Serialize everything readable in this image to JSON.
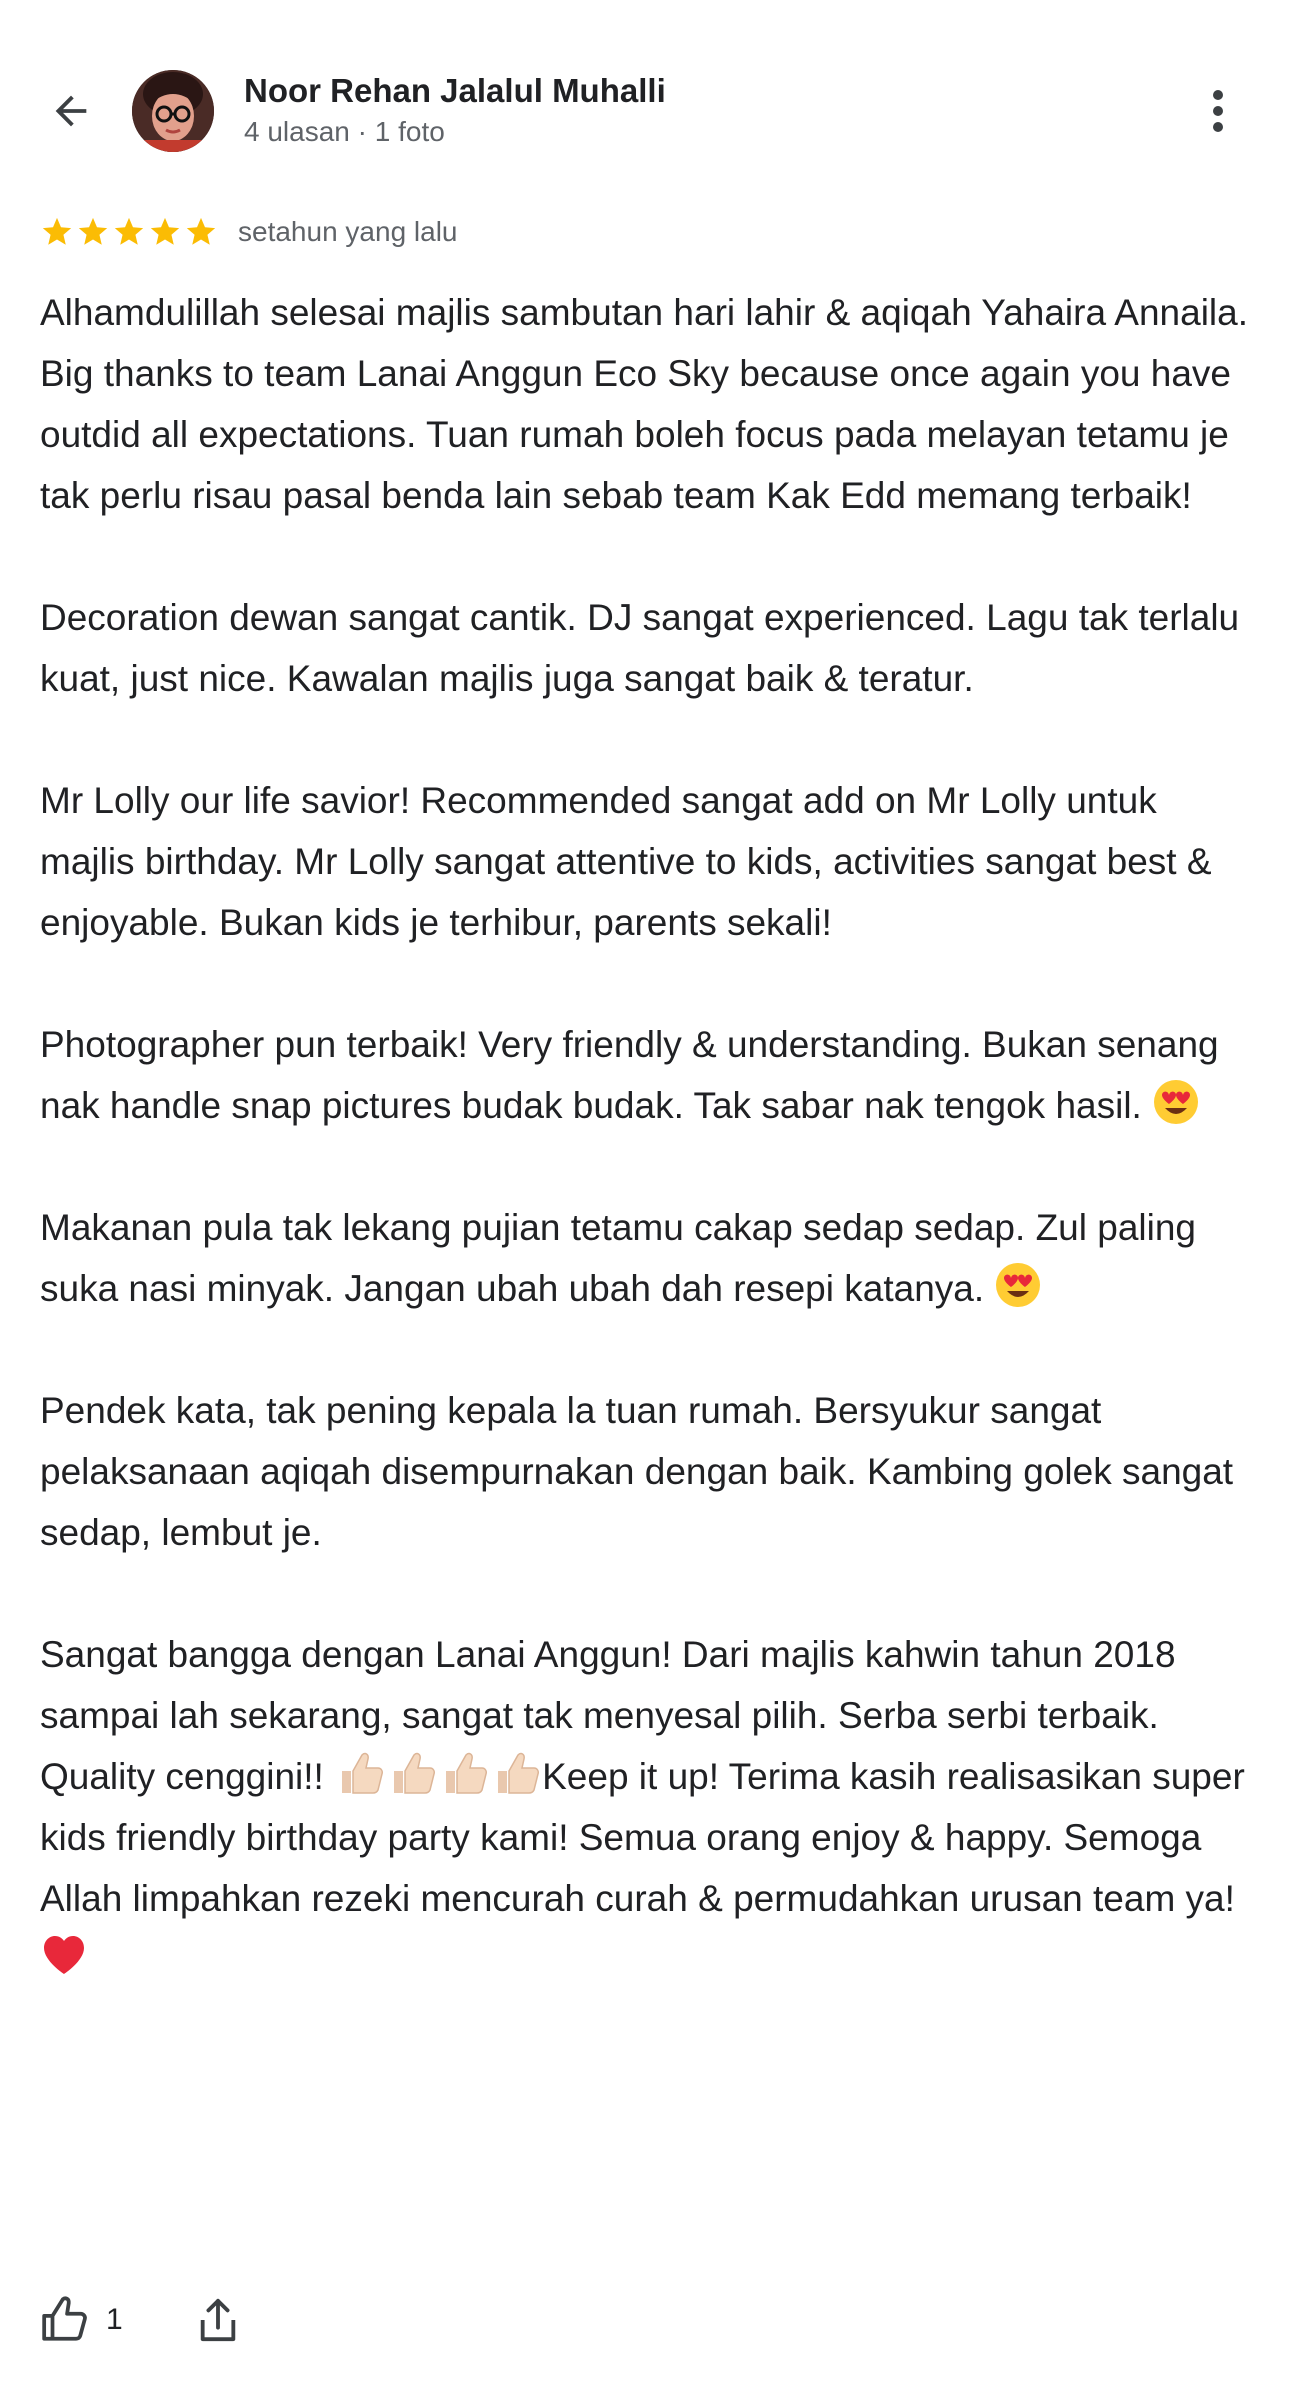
{
  "author": {
    "name": "Noor Rehan Jalalul Muhalli",
    "meta": "4 ulasan · 1 foto"
  },
  "rating": {
    "stars": 5,
    "date": "setahun yang lalu"
  },
  "review": {
    "p1": "Alhamdulillah selesai majlis sambutan hari lahir & aqiqah Yahaira Annaila. Big thanks to team Lanai Anggun Eco Sky because once again you have outdid all expectations. Tuan rumah boleh focus pada melayan tetamu je tak perlu risau pasal benda lain sebab team Kak Edd memang terbaik!",
    "p2": "Decoration dewan sangat cantik. DJ sangat experienced. Lagu tak terlalu kuat, just nice. Kawalan majlis juga sangat baik & teratur.",
    "p3": "Mr Lolly our life savior! Recommended sangat add on Mr Lolly untuk majlis birthday. Mr Lolly sangat attentive to kids, activities sangat best & enjoyable. Bukan kids je terhibur, parents sekali!",
    "p4": "Photographer pun terbaik! Very friendly & understanding. Bukan senang nak handle snap pictures budak budak. Tak sabar nak tengok hasil. ",
    "p5": "Makanan pula tak lekang pujian tetamu cakap sedap sedap. Zul paling suka nasi minyak. Jangan ubah ubah dah resepi katanya. ",
    "p6": "Pendek kata, tak pening kepala la tuan rumah. Bersyukur sangat pelaksanaan aqiqah disempurnakan dengan baik. Kambing golek sangat sedap, lembut je.",
    "p7a": "Sangat bangga dengan Lanai Anggun! Dari majlis kahwin tahun 2018 sampai lah sekarang, sangat tak menyesal pilih. Serba serbi terbaik. Quality cenggini!! ",
    "p7b": "Keep it up! Terima kasih realisasikan super kids friendly birthday party kami! Semua orang enjoy & happy. Semoga Allah limpahkan rezeki mencurah curah & permudahkan urusan team ya! "
  },
  "actions": {
    "like_count": "1"
  },
  "colors": {
    "star": "#fbbc04",
    "text_primary": "#202124",
    "text_secondary": "#5f6368",
    "icon": "#3c4043"
  }
}
